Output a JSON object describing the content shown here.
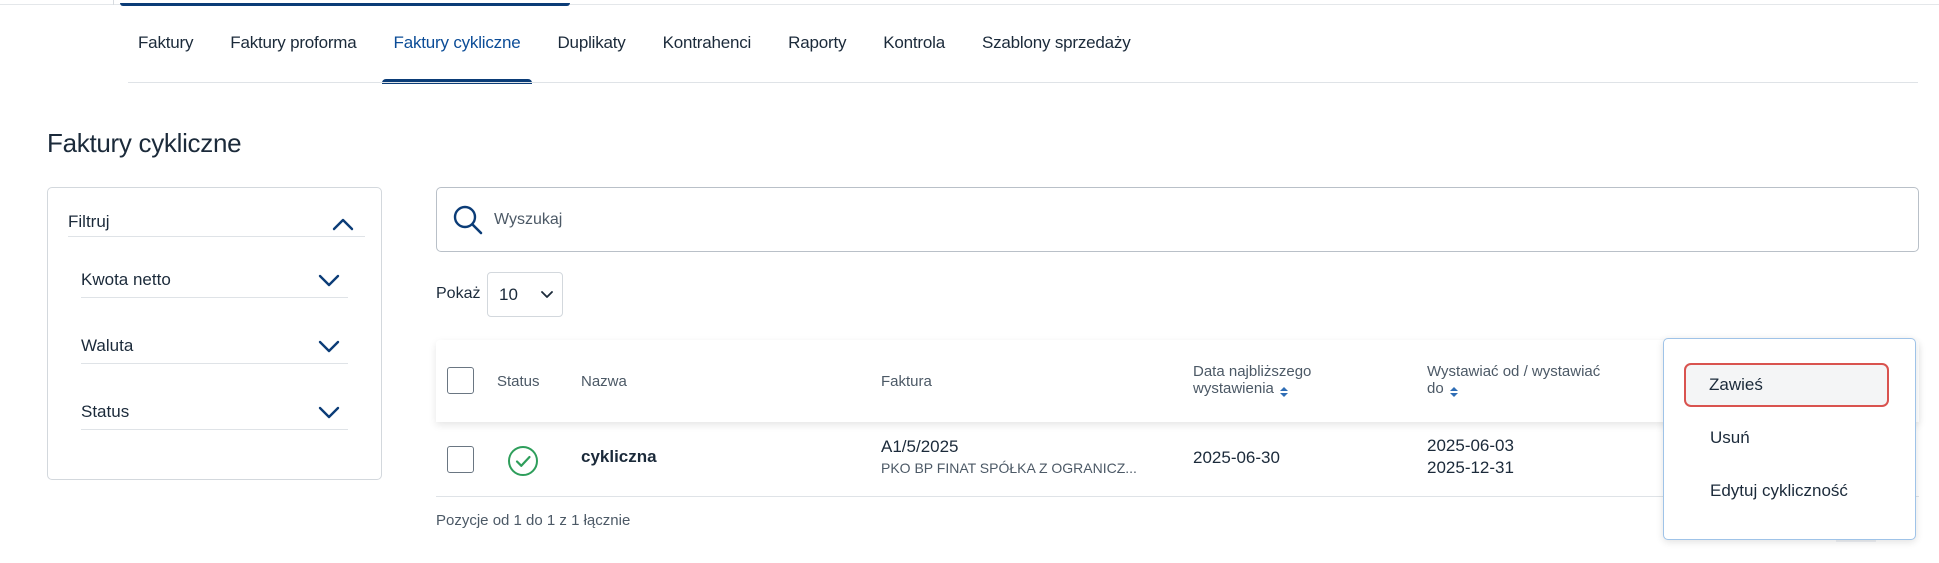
{
  "tabs": [
    {
      "label": "Faktury",
      "active": false
    },
    {
      "label": "Faktury proforma",
      "active": false
    },
    {
      "label": "Faktury cykliczne",
      "active": true
    },
    {
      "label": "Duplikaty",
      "active": false
    },
    {
      "label": "Kontrahenci",
      "active": false
    },
    {
      "label": "Raporty",
      "active": false
    },
    {
      "label": "Kontrola",
      "active": false
    },
    {
      "label": "Szablony sprzedaży",
      "active": false
    }
  ],
  "page": {
    "title": "Faktury cykliczne"
  },
  "filters": {
    "header": "Filtruj",
    "items": [
      {
        "label": "Kwota netto"
      },
      {
        "label": "Waluta"
      },
      {
        "label": "Status"
      }
    ]
  },
  "search": {
    "placeholder": "Wyszukaj",
    "value": ""
  },
  "show": {
    "label": "Pokaż",
    "value": "10"
  },
  "table": {
    "columns": {
      "status": "Status",
      "name": "Nazwa",
      "invoice": "Faktura",
      "next_date_line1": "Data najbliższego",
      "next_date_line2": "wystawienia",
      "issue_range_line1": "Wystawiać od / wystawiać",
      "issue_range_line2": "do"
    },
    "rows": [
      {
        "status": "active",
        "name": "cykliczna",
        "invoice_number": "A1/5/2025",
        "contractor": "PKO BP FINAT SPÓŁKA Z OGRANICZ...",
        "next_date": "2025-06-30",
        "issue_from": "2025-06-03",
        "issue_to": "2025-12-31"
      }
    ]
  },
  "pagination": {
    "summary": "Pozycje od 1 do 1 z 1 łącznie"
  },
  "context_menu": {
    "items": [
      {
        "label": "Zawieś",
        "highlighted": true
      },
      {
        "label": "Usuń",
        "highlighted": false
      },
      {
        "label": "Edytuj cykliczność",
        "highlighted": false
      }
    ]
  },
  "colors": {
    "accent": "#0b3c77",
    "success": "#2e9e5b",
    "highlight_border": "#d9534f",
    "menu_border": "#9fc3e8"
  }
}
